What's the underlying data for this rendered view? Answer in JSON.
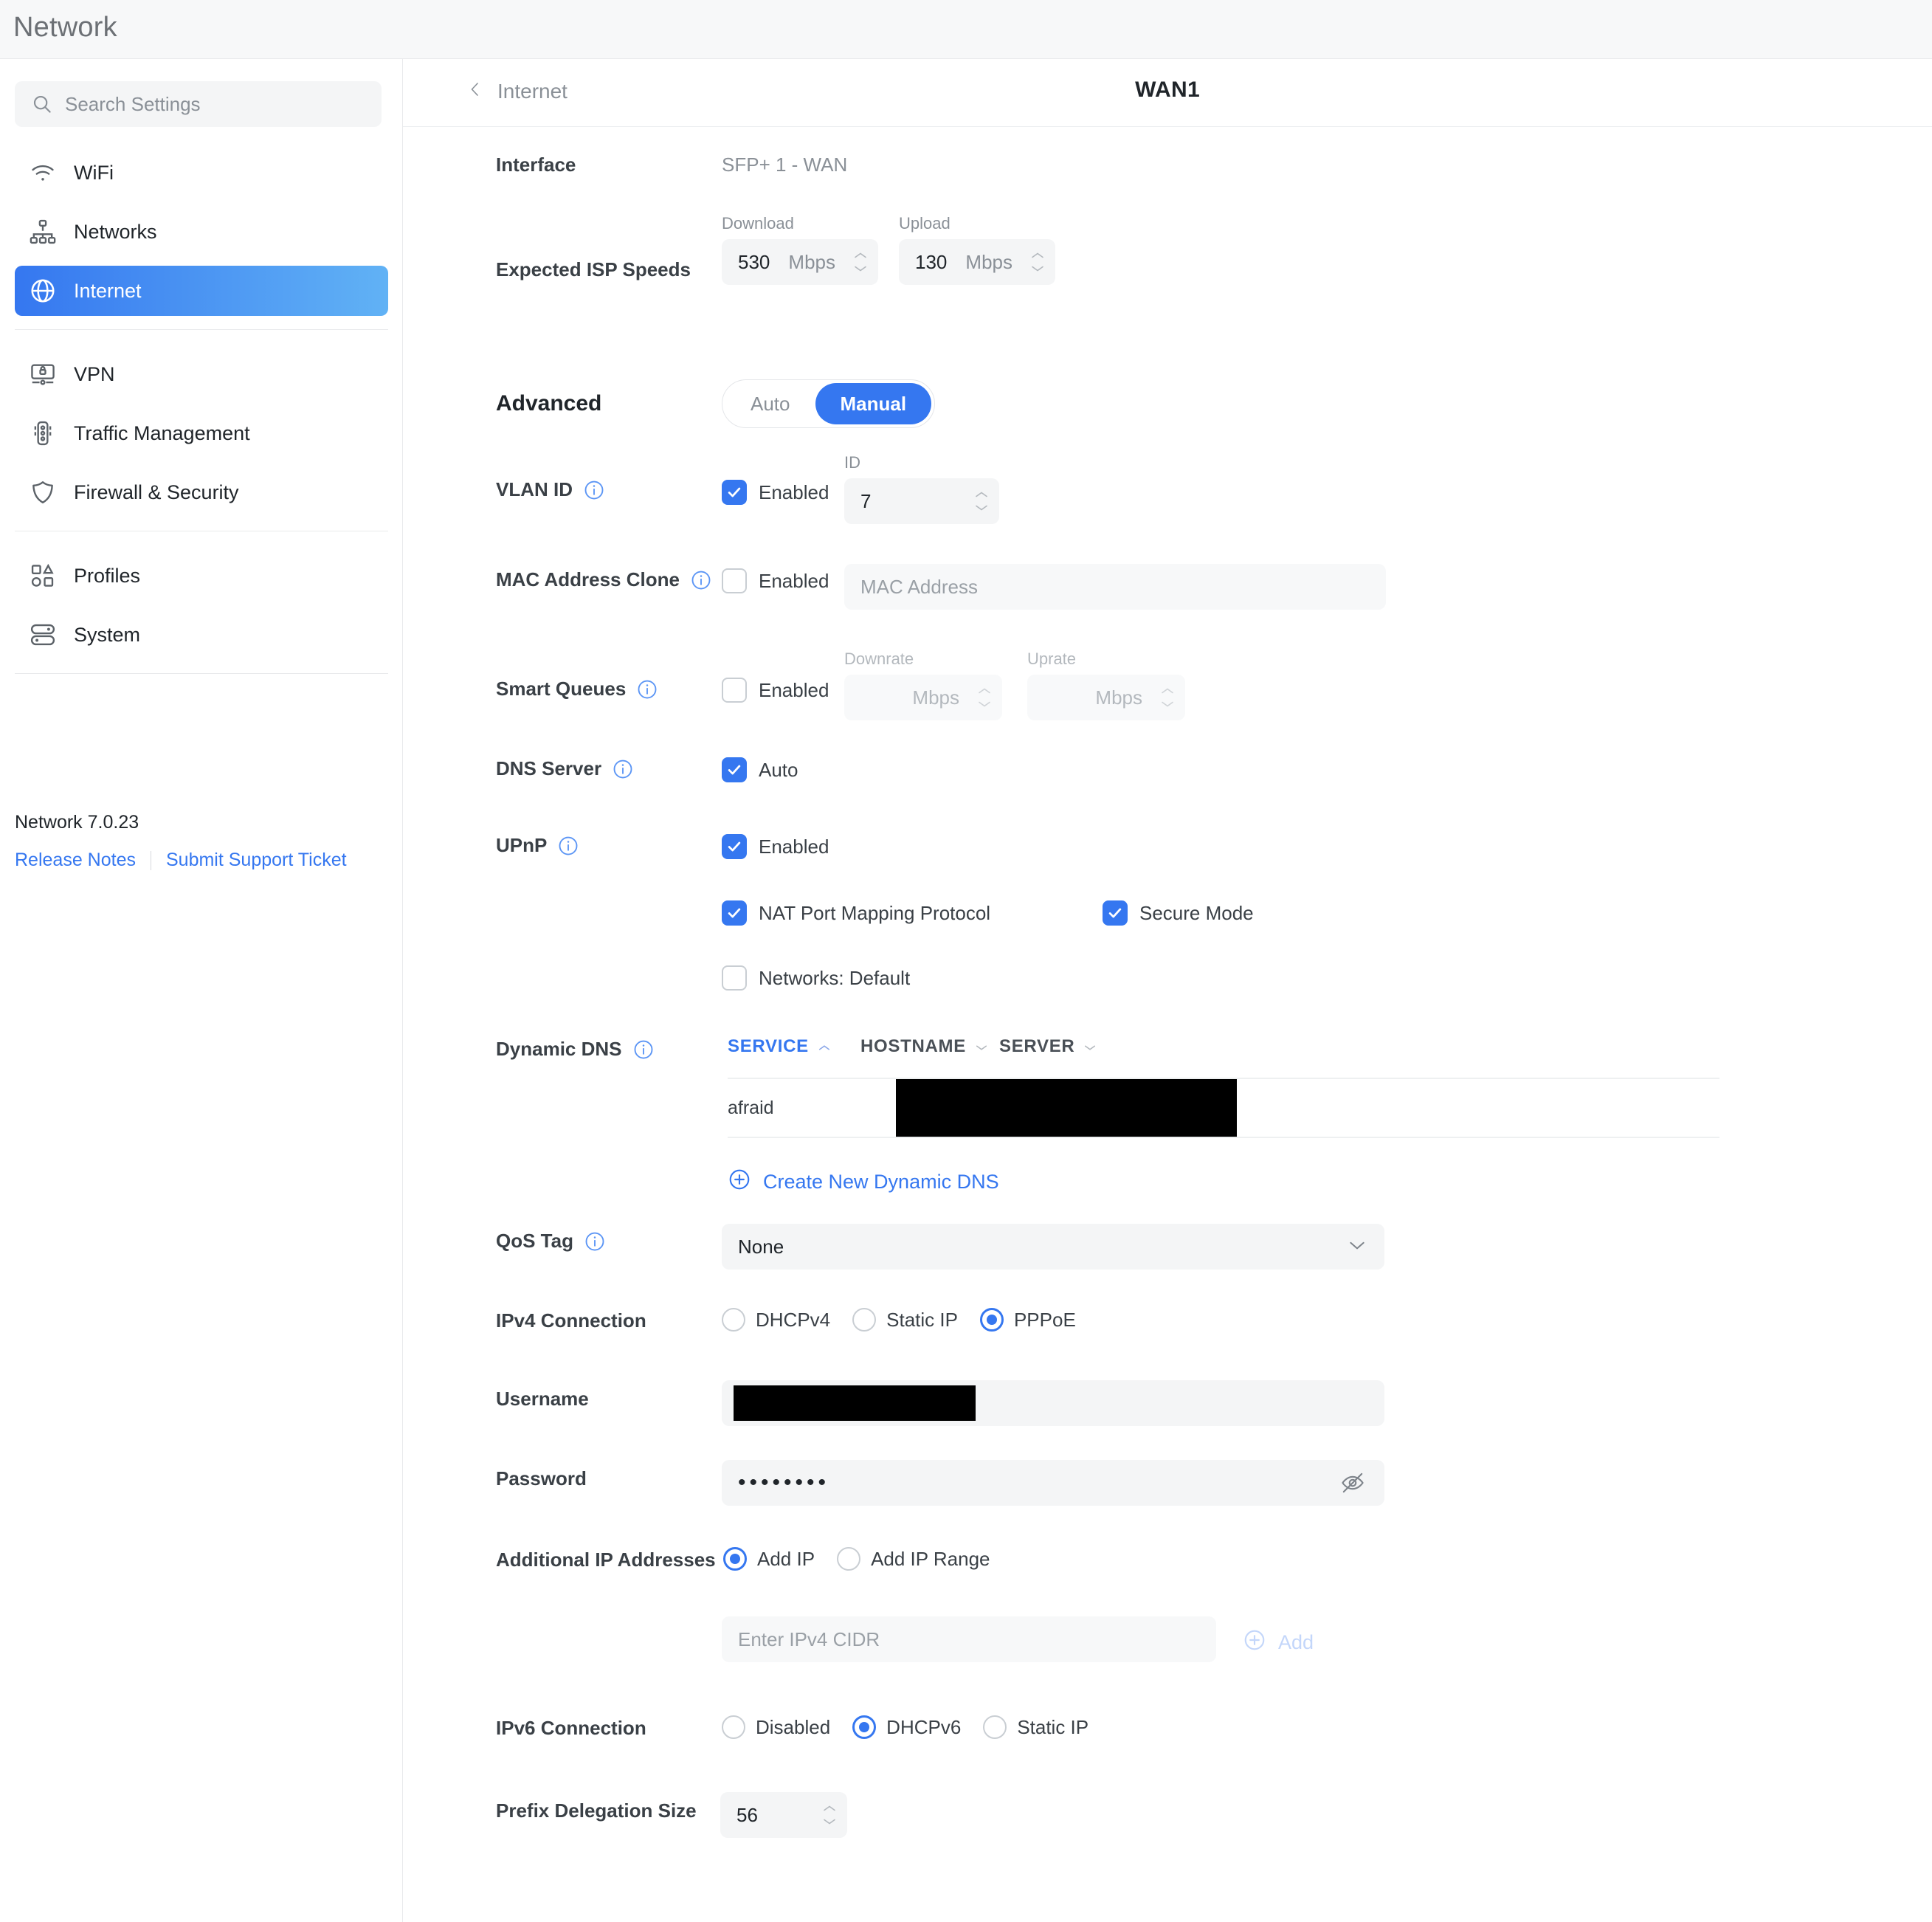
{
  "app": {
    "title": "Network"
  },
  "sidebar": {
    "search": {
      "placeholder": "Search Settings",
      "value": ""
    },
    "items": [
      {
        "label": "WiFi",
        "icon": "wifi-icon",
        "active": false
      },
      {
        "label": "Networks",
        "icon": "network-topology-icon",
        "active": false
      },
      {
        "label": "Internet",
        "icon": "globe-icon",
        "active": true
      },
      {
        "label": "VPN",
        "icon": "vpn-lock-icon",
        "active": false
      },
      {
        "label": "Traffic Management",
        "icon": "traffic-light-icon",
        "active": false
      },
      {
        "label": "Firewall & Security",
        "icon": "shield-icon",
        "active": false
      },
      {
        "label": "Profiles",
        "icon": "profiles-shapes-icon",
        "active": false
      },
      {
        "label": "System",
        "icon": "system-icon",
        "active": false
      }
    ],
    "version": "Network 7.0.23",
    "release_notes": "Release Notes",
    "support_ticket": "Submit Support Ticket"
  },
  "header": {
    "breadcrumb": "Internet",
    "title": "WAN1"
  },
  "form": {
    "interface": {
      "label": "Interface",
      "value": "SFP+ 1 - WAN"
    },
    "isp_speeds": {
      "label": "Expected ISP Speeds",
      "download_label": "Download",
      "download_value": "530",
      "download_unit": "Mbps",
      "upload_label": "Upload",
      "upload_value": "130",
      "upload_unit": "Mbps"
    },
    "advanced": {
      "label": "Advanced",
      "options": [
        "Auto",
        "Manual"
      ],
      "selected": "Manual"
    },
    "vlan": {
      "label": "VLAN ID",
      "enabled_label": "Enabled",
      "enabled": true,
      "id_label": "ID",
      "id_value": "7"
    },
    "mac_clone": {
      "label": "MAC Address Clone",
      "enabled_label": "Enabled",
      "enabled": false,
      "placeholder": "MAC Address",
      "value": ""
    },
    "smart_queues": {
      "label": "Smart Queues",
      "enabled_label": "Enabled",
      "enabled": false,
      "downrate_label": "Downrate",
      "downrate_unit": "Mbps",
      "downrate_value": "",
      "uprate_label": "Uprate",
      "uprate_unit": "Mbps",
      "uprate_value": ""
    },
    "dns_server": {
      "label": "DNS Server",
      "auto_label": "Auto",
      "auto": true
    },
    "upnp": {
      "label": "UPnP",
      "enabled_label": "Enabled",
      "enabled": true,
      "nat_pmp_label": "NAT Port Mapping Protocol",
      "nat_pmp": true,
      "secure_mode_label": "Secure Mode",
      "secure_mode": true,
      "networks_label": "Networks: Default",
      "networks": false
    },
    "dynamic_dns": {
      "label": "Dynamic DNS",
      "columns": [
        "SERVICE",
        "HOSTNAME",
        "SERVER"
      ],
      "sorted_column": "SERVICE",
      "sort_direction": "asc",
      "rows": [
        {
          "service": "afraid",
          "hostname": "",
          "server": ""
        }
      ],
      "create_label": "Create New Dynamic DNS"
    },
    "qos_tag": {
      "label": "QoS Tag",
      "value": "None"
    },
    "ipv4": {
      "label": "IPv4 Connection",
      "options": [
        "DHCPv4",
        "Static IP",
        "PPPoE"
      ],
      "selected": "PPPoE"
    },
    "username": {
      "label": "Username",
      "value": ""
    },
    "password": {
      "label": "Password",
      "value": "••••••••"
    },
    "additional_ip": {
      "label": "Additional IP Addresses",
      "options": [
        "Add IP",
        "Add IP Range"
      ],
      "selected": "Add IP",
      "placeholder": "Enter IPv4 CIDR",
      "value": "",
      "add_label": "Add"
    },
    "ipv6": {
      "label": "IPv6 Connection",
      "options": [
        "Disabled",
        "DHCPv6",
        "Static IP"
      ],
      "selected": "DHCPv6"
    },
    "prefix_delegation": {
      "label": "Prefix Delegation Size",
      "value": "56"
    }
  },
  "colors": {
    "accent": "#3577f0",
    "field_bg": "#f4f5f6",
    "label": "#3a4046",
    "muted": "#8a9097"
  }
}
